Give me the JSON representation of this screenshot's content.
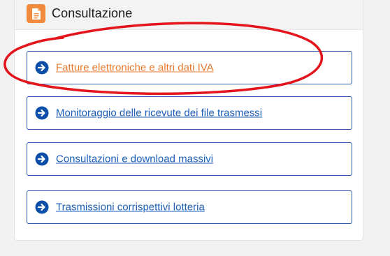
{
  "panel": {
    "title": "Consultazione",
    "header_icon": "document-icon",
    "links": [
      {
        "label": "Fatture elettroniche e altri dati IVA",
        "color": "#e8792e",
        "icon": "arrow-right-circle-icon"
      },
      {
        "label": "Monitoraggio delle ricevute dei file trasmessi",
        "color": "#1c5fb8",
        "icon": "arrow-right-circle-icon"
      },
      {
        "label": "Consultazioni e download massivi",
        "color": "#1c5fb8",
        "icon": "arrow-right-circle-icon"
      },
      {
        "label": "Trasmissioni corrispettivi lotteria",
        "color": "#1c5fb8",
        "icon": "arrow-right-circle-icon"
      }
    ]
  },
  "colors": {
    "accent": "#f08a3c",
    "link": "#1c5fb8",
    "link_active": "#e8792e",
    "border": "#2b5aa8",
    "annotation": "#e3141b"
  }
}
